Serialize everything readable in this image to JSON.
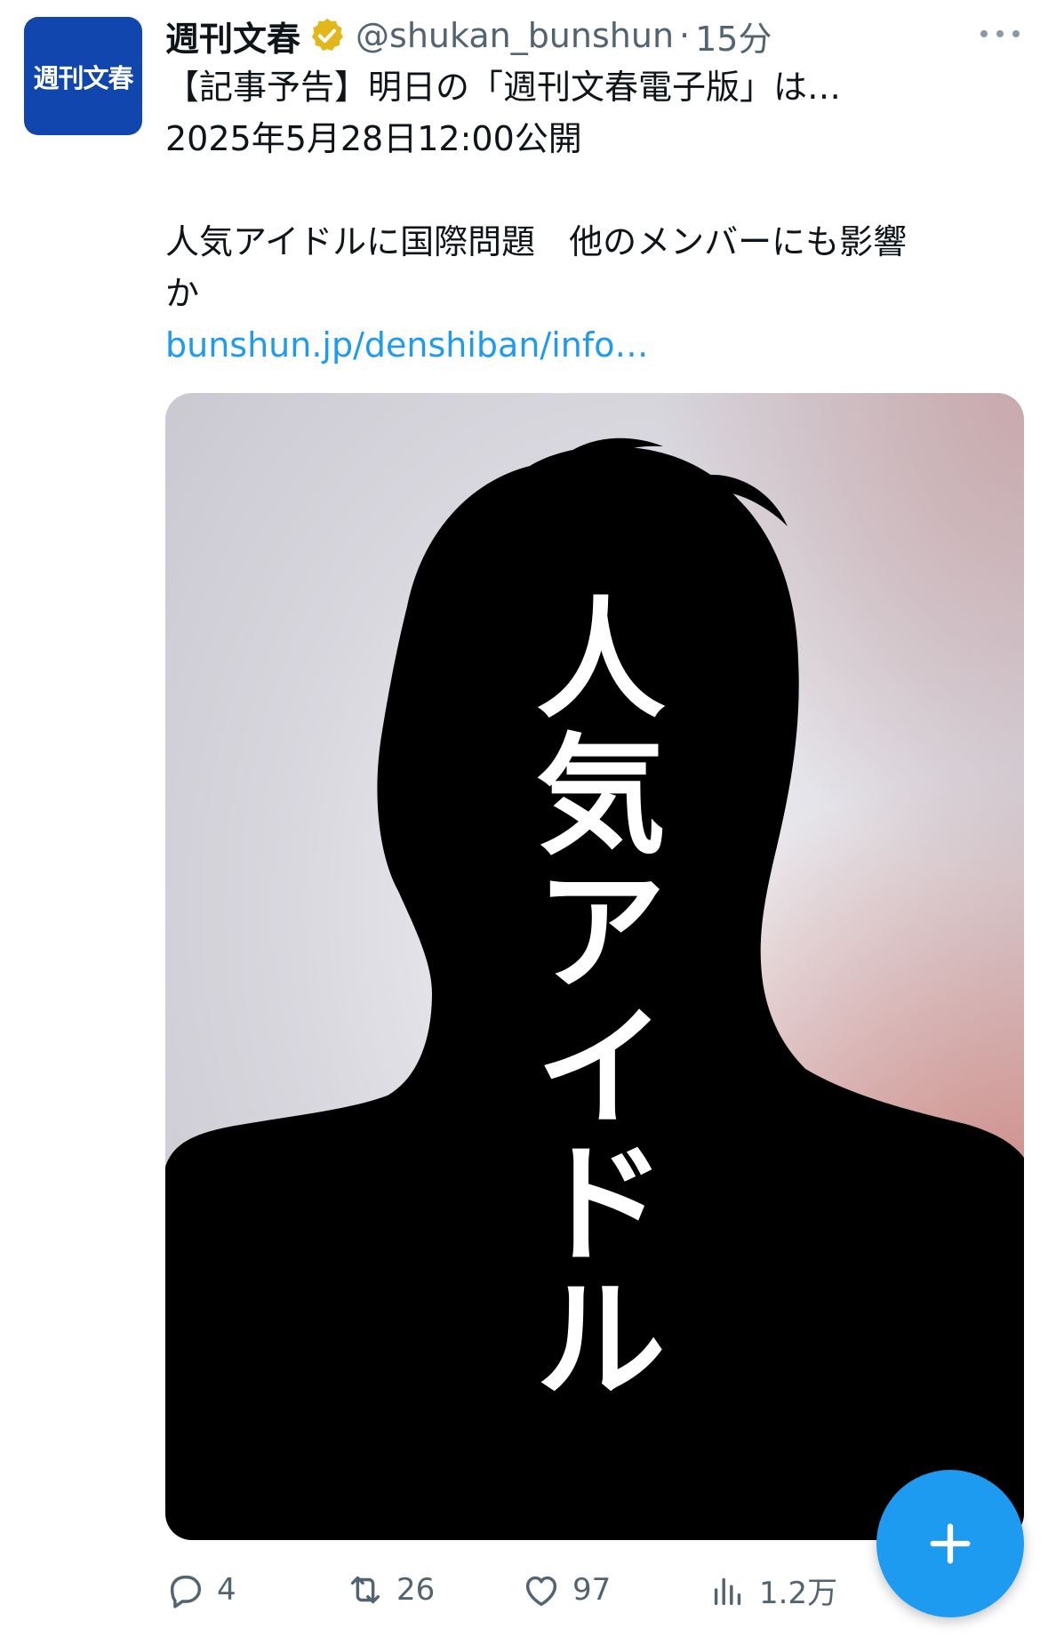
{
  "tweet": {
    "author": {
      "avatar_text": "週刊文春",
      "display_name": "週刊文春",
      "handle": "@shukan_bunshun",
      "separator": "·",
      "time": "15分",
      "verified_badge": "gold-check-badge"
    },
    "lines": [
      "【記事予告】明日の「週刊文春電子版」は…",
      "2025年5月28日12:00公開",
      "人気アイドルに国際問題　他のメンバーにも影響",
      "か"
    ],
    "link": "bunshun.jp/denshiban/info…",
    "media": {
      "headline": "人気アイドル"
    },
    "actions": {
      "reply_count": "4",
      "retweet_count": "26",
      "like_count": "97",
      "views_count": "1.2万"
    }
  },
  "fab": {
    "icon": "plus-icon"
  },
  "colors": {
    "brand_blue": "#1d9bf0",
    "avatar_blue": "#1046ae",
    "text_primary": "#0f1419",
    "text_secondary": "#536471",
    "verified_gold": "#e2b719"
  }
}
